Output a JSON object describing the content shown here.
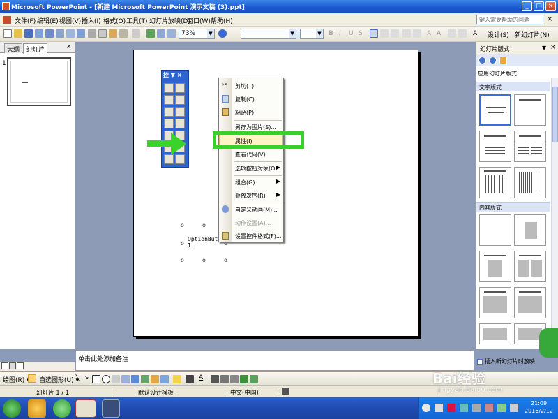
{
  "window": {
    "title": "Microsoft PowerPoint - [新建 Microsoft PowerPoint 演示文稿 (3).ppt]"
  },
  "menubar": {
    "items": [
      "文件(F)",
      "编辑(E)",
      "视图(V)",
      "插入(I)",
      "格式(O)",
      "工具(T)",
      "幻灯片放映(D)",
      "窗口(W)",
      "帮助(H)"
    ],
    "help_placeholder": "键入需要帮助的问题"
  },
  "toolbar": {
    "zoom": "73%",
    "design_label": "设计(S)",
    "new_slide_label": "新幻灯片(N)"
  },
  "leftpanel": {
    "tab_outline": "大纲",
    "tab_slides": "幻灯片",
    "close": "x",
    "slide_number": "1"
  },
  "toolbox": {
    "title": "控"
  },
  "context_menu": {
    "items": [
      {
        "label": "剪切(T)",
        "icon": "scissors-icon",
        "disabled": false
      },
      {
        "label": "复制(C)",
        "icon": "copy-icon",
        "disabled": false
      },
      {
        "label": "粘贴(P)",
        "icon": "paste-icon",
        "disabled": false
      },
      {
        "label": "另存为图片(S)...",
        "icon": "",
        "disabled": false
      },
      {
        "label": "属性(I)",
        "icon": "",
        "disabled": false,
        "highlighted": true
      },
      {
        "label": "查看代码(V)",
        "icon": "",
        "disabled": false
      },
      {
        "label": "选项按钮对象(O)",
        "icon": "",
        "disabled": false,
        "submenu": true
      },
      {
        "label": "组合(G)",
        "icon": "",
        "disabled": false,
        "submenu": true
      },
      {
        "label": "叠放次序(R)",
        "icon": "",
        "disabled": false,
        "submenu": true
      },
      {
        "label": "自定义动画(M)...",
        "icon": "animation-icon",
        "disabled": false
      },
      {
        "label": "动作设置(A)...",
        "icon": "",
        "disabled": true
      },
      {
        "label": "设置控件格式(F)...",
        "icon": "format-icon",
        "disabled": false
      }
    ]
  },
  "slide": {
    "option_button_label": "OptionButto\n1"
  },
  "taskpane": {
    "title": "幻灯片版式",
    "apply_label": "应用幻灯片版式:",
    "section_text": "文字版式",
    "section_content": "内容版式",
    "checkbox_label": "插入新幻灯片时放映"
  },
  "notes": {
    "placeholder": "单击此处添加备注"
  },
  "drawbar": {
    "draw_label": "绘图(R)",
    "autoshape_label": "自选图形(U)"
  },
  "statusbar": {
    "slide": "幻灯片 1 / 1",
    "design": "默认设计模板",
    "lang": "中文(中国)"
  },
  "taskbar": {
    "time": "21:09",
    "date": "2016/2/12"
  },
  "watermark": {
    "brand": "Bai经验",
    "url": "jingyan.baidu.com"
  },
  "colors": {
    "highlight_green": "#3ad02c",
    "title_blue": "#1857cf",
    "toolbox_blue": "#2e64d0"
  }
}
